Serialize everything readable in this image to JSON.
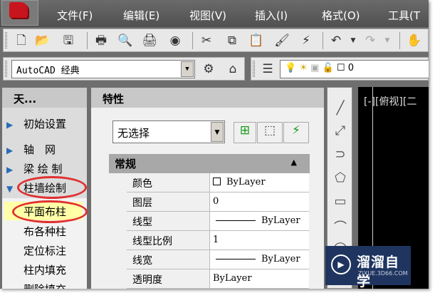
{
  "menu": [
    "文件(F)",
    "编辑(E)",
    "视图(V)",
    "插入(I)",
    "格式(O)",
    "工具(T"
  ],
  "workspace": {
    "value": "AutoCAD 经典"
  },
  "layer": {
    "value": "0"
  },
  "tianzheng": {
    "title": "天...",
    "items": [
      "初始设置",
      "轴　网",
      "梁 绘 制",
      "柱墙绘制"
    ],
    "subitems": [
      "平面布柱",
      "布各种柱",
      "定位标注",
      "柱内填充",
      "删除填充"
    ]
  },
  "properties": {
    "title": "特性",
    "selection": "无选择",
    "section": "常规",
    "rows": [
      {
        "k": "颜色",
        "v": "ByLayer"
      },
      {
        "k": "图层",
        "v": "0"
      },
      {
        "k": "线型",
        "v": "ByLayer"
      },
      {
        "k": "线型比例",
        "v": "1"
      },
      {
        "k": "线宽",
        "v": "ByLayer"
      },
      {
        "k": "透明度",
        "v": "ByLayer"
      }
    ]
  },
  "viewport": {
    "label": "[-][俯视][二"
  },
  "watermark": {
    "name": "溜溜自学",
    "url": "ZIXUE.3D66.COM"
  }
}
